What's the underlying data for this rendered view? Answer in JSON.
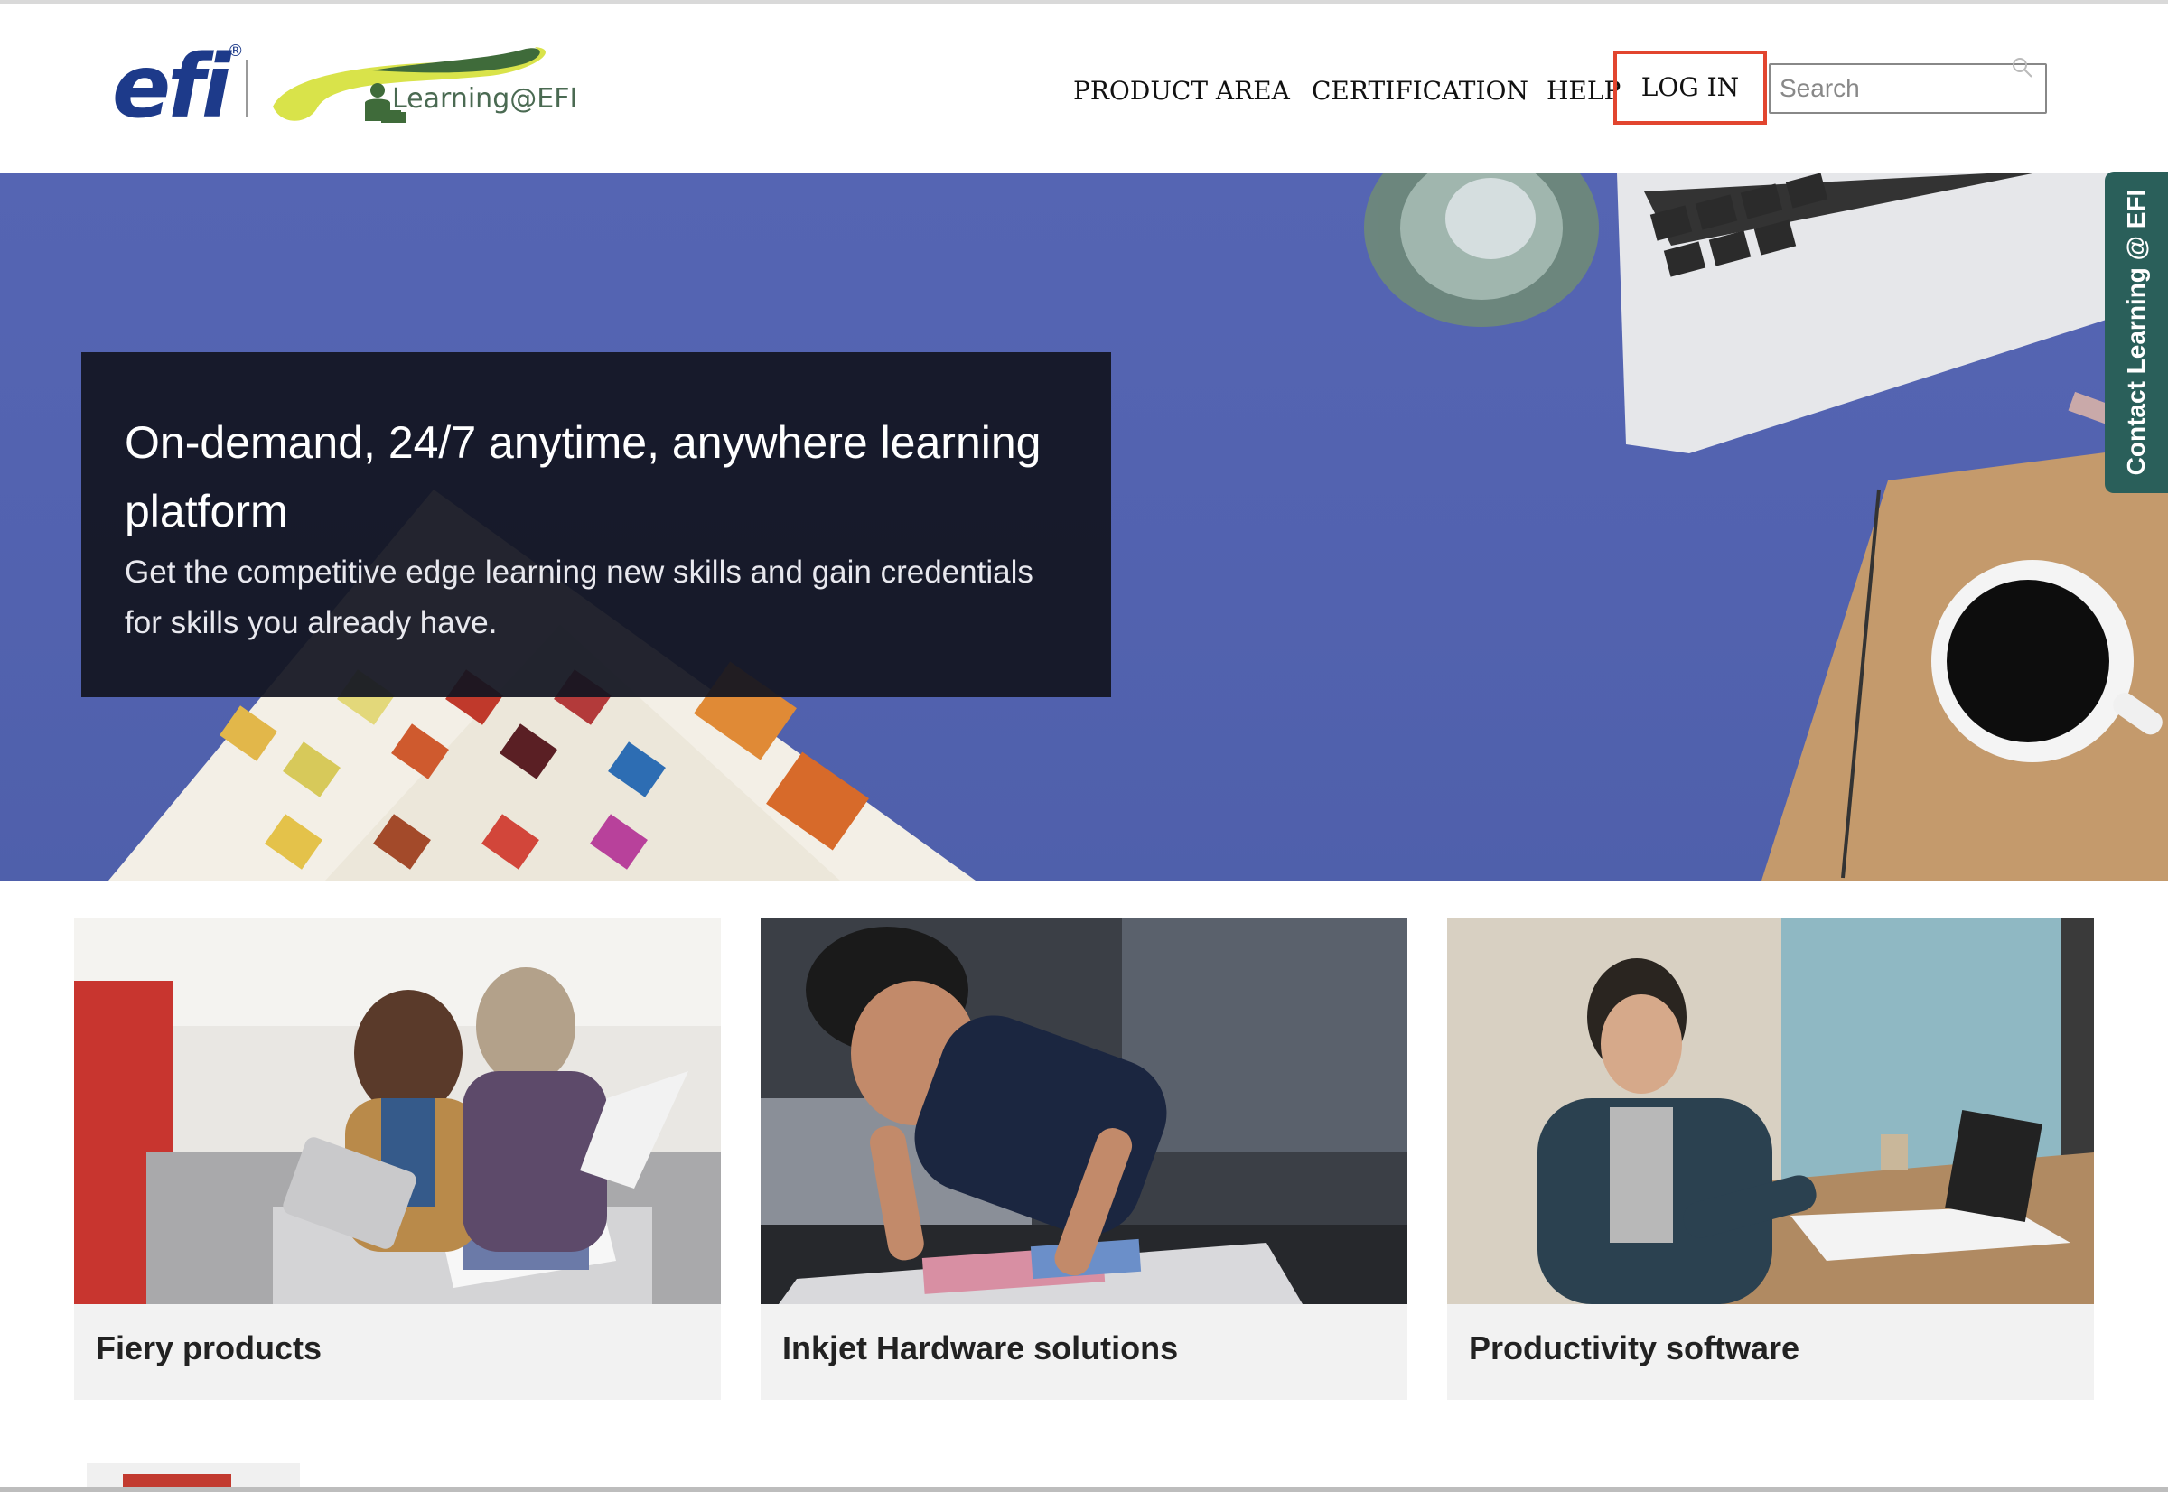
{
  "header": {
    "logo_text": "efi",
    "logo_registered": "®",
    "sub_logo_text": "Learning@EFI",
    "nav": {
      "product_area": "PRODUCT AREA",
      "certification": "CERTIFICATION",
      "help": "HELP",
      "login": "LOG IN"
    },
    "search": {
      "placeholder": "Search",
      "value": ""
    }
  },
  "hero": {
    "title": "On-demand, 24/7 anytime, anywhere learning platform",
    "subtitle": "Get the competitive edge learning new skills and gain credentials for skills you already have."
  },
  "contact_tab": {
    "label": "Contact Learning @ EFI"
  },
  "cards": [
    {
      "title": "Fiery products"
    },
    {
      "title": "Inkjet Hardware solutions"
    },
    {
      "title": "Productivity software"
    }
  ],
  "colors": {
    "brand_blue": "#1d3a8a",
    "hero_blue": "#5262af",
    "login_highlight": "#e2452f",
    "contact_tab": "#2a5f5a",
    "logo_yellow": "#d9e34a",
    "logo_green": "#3f6b3a"
  },
  "icons": {
    "search": "search-icon",
    "user": "learner-icon"
  }
}
